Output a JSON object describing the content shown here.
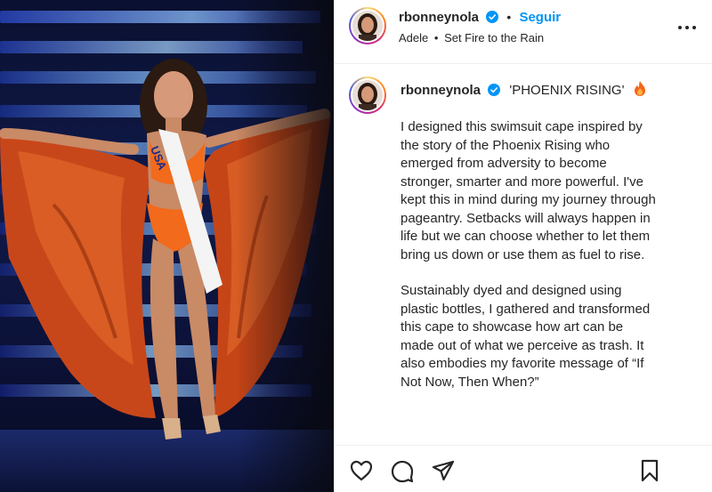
{
  "header": {
    "username": "rbonneynola",
    "separator": "•",
    "follow_label": "Seguir",
    "audio_artist": "Adele",
    "audio_separator": "•",
    "audio_title": "Set Fire to the Rain"
  },
  "caption": {
    "username": "rbonneynola",
    "title": "'PHOENIX RISING'",
    "paragraphs": [
      "I designed this swimsuit cape inspired by the story of the Phoenix Rising who emerged from adversity to become stronger, smarter and more powerful. I've kept this in mind during my journey through pageantry. Setbacks will always happen in life but we can choose whether to let them bring us down or use them as fuel to rise.",
      "Sustainably dyed and designed using plastic bottles, I gathered and transformed this cape to showcase how art can be made out of what we perceive as trash. It also embodies my favorite message of “If Not Now, Then When?”"
    ]
  },
  "photo": {
    "sash_text": "USA"
  },
  "colors": {
    "follow_blue": "#0095f6",
    "verified_blue": "#0095f6",
    "cape_orange": "#d9561c",
    "swimsuit_orange": "#f26a1b",
    "stage_blue": "#1a2c8a"
  },
  "icons": {
    "more": "more-horizontal-icon",
    "like": "heart-icon",
    "comment": "comment-icon",
    "share": "paper-plane-icon",
    "save": "bookmark-icon",
    "verified": "verified-badge-icon",
    "fire": "fire-emoji-icon"
  }
}
